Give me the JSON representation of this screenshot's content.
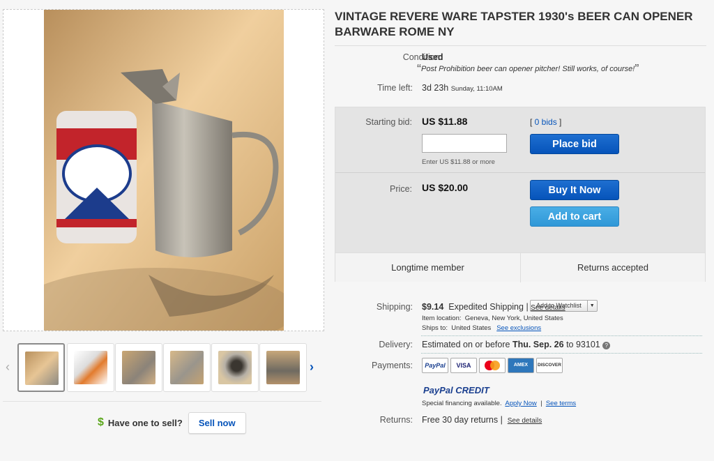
{
  "listing": {
    "title": "VINTAGE REVERE WARE TAPSTER 1930's BEER CAN OPENER BARWARE ROME NY",
    "condition_label": "Condition:",
    "condition_value": "Used",
    "condition_quote": "Post Prohibition beer can opener pitcher! Still works, of course!",
    "time_label": "Time left:",
    "time_value": "3d 23h",
    "time_detail": "Sunday, 11:10AM"
  },
  "bid": {
    "starting_label": "Starting bid:",
    "starting_price": "US $11.88",
    "bids_link": "0 bids",
    "input_placeholder": "",
    "hint": "Enter US $11.88 or more",
    "place_bid": "Place bid"
  },
  "buy": {
    "price_label": "Price:",
    "price": "US $20.00",
    "buy_now": "Buy It Now",
    "add_to_cart": "Add to cart",
    "watchlist": "Add to Watchlist"
  },
  "badges": {
    "left": "Longtime member",
    "right": "Returns accepted"
  },
  "shipping": {
    "label": "Shipping:",
    "cost": "$9.14",
    "method": "Expedited Shipping",
    "details_link": "See details",
    "location_label": "Item location:",
    "location": "Geneva, New York, United States",
    "ships_to_label": "Ships to:",
    "ships_to": "United States",
    "exclusions_link": "See exclusions"
  },
  "delivery": {
    "label": "Delivery:",
    "text": "Estimated on or before",
    "date": "Thu. Sep. 26",
    "to": "to 93101"
  },
  "payments": {
    "label": "Payments:",
    "logos": [
      "PayPal",
      "VISA",
      "MC",
      "AMEX",
      "DISCOVER"
    ],
    "credit_logo": "PayPal CREDIT",
    "financing": "Special financing available.",
    "apply_link": "Apply Now",
    "terms_link": "See terms"
  },
  "returns": {
    "label": "Returns:",
    "text": "Free 30 day returns",
    "details_link": "See details"
  },
  "sell": {
    "dollar": "$",
    "question": "Have one to sell?",
    "button": "Sell now"
  },
  "colors": {
    "primary_button": "#0654ba",
    "secondary_button": "#2f97d7",
    "link": "#0654ba"
  }
}
